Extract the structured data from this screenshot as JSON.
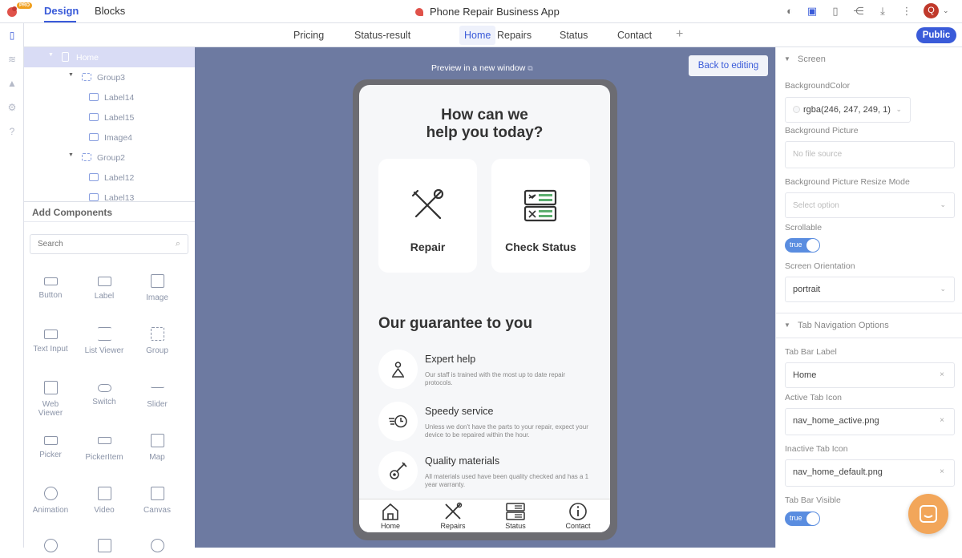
{
  "topbar": {
    "pro_badge": "PRO",
    "tabs": [
      {
        "label": "Design"
      },
      {
        "label": "Blocks"
      }
    ],
    "app_title": "Phone Repair Business App",
    "avatar_letter": "Q",
    "icons": [
      "contrast-icon",
      "tablet-frame-icon",
      "phone-icon",
      "share-icon",
      "download-icon",
      "more-vertical-icon"
    ]
  },
  "screen_tabs": {
    "items": [
      {
        "label": "Pricing"
      },
      {
        "label": "Status-result"
      },
      {
        "label": "Home"
      },
      {
        "label": "Repairs"
      },
      {
        "label": "Status"
      },
      {
        "label": "Contact"
      }
    ],
    "add_label": "+",
    "public_label": "Public",
    "active": "Home"
  },
  "tree": {
    "items": [
      {
        "label": "Home"
      },
      {
        "label": "Group3"
      },
      {
        "label": "Label14"
      },
      {
        "label": "Label15"
      },
      {
        "label": "Image4"
      },
      {
        "label": "Group2"
      },
      {
        "label": "Label12"
      },
      {
        "label": "Label13"
      }
    ]
  },
  "components": {
    "header": "Add Components",
    "search_placeholder": "Search",
    "items": [
      {
        "label": "Button"
      },
      {
        "label": "Label"
      },
      {
        "label": "Image"
      },
      {
        "label": "Text Input"
      },
      {
        "label": "List Viewer"
      },
      {
        "label": "Group"
      },
      {
        "label": "Web Viewer"
      },
      {
        "label": "Switch"
      },
      {
        "label": "Slider"
      },
      {
        "label": "Picker"
      },
      {
        "label": "PickerItem"
      },
      {
        "label": "Map"
      },
      {
        "label": "Animation"
      },
      {
        "label": "Video"
      },
      {
        "label": "Canvas"
      }
    ]
  },
  "canvas": {
    "preview_link": "Preview in a new window",
    "back_button": "Back to editing",
    "background": "#6d7aa1"
  },
  "phone": {
    "title_line1": "How can we",
    "title_line2": "help you today?",
    "cards": [
      {
        "label": "Repair"
      },
      {
        "label": "Check Status"
      }
    ],
    "guarantee_title": "Our guarantee to you",
    "features": [
      {
        "title": "Expert help",
        "desc": "Our staff is trained with the most up to date repair protocols."
      },
      {
        "title": "Speedy service",
        "desc": "Unless we don't have the parts to your repair, expect your device to be repaired within the hour."
      },
      {
        "title": "Quality materials",
        "desc": "All materials used have been quality checked and has a 1 year warranty."
      }
    ],
    "tabbar": [
      {
        "label": "Home"
      },
      {
        "label": "Repairs"
      },
      {
        "label": "Status"
      },
      {
        "label": "Contact"
      }
    ]
  },
  "properties": {
    "screen_section": "Screen",
    "background_color_label": "BackgroundColor",
    "background_color_value": "rgba(246, 247, 249, 1)",
    "background_picture_label": "Background Picture",
    "background_picture_placeholder": "No file source",
    "resize_mode_label": "Background Picture Resize Mode",
    "resize_mode_placeholder": "Select option",
    "scrollable_label": "Scrollable",
    "scrollable_value": "true",
    "orientation_label": "Screen Orientation",
    "orientation_value": "portrait",
    "tab_section": "Tab Navigation Options",
    "tab_bar_label_label": "Tab Bar Label",
    "tab_bar_label_value": "Home",
    "active_icon_label": "Active Tab Icon",
    "active_icon_value": "nav_home_active.png",
    "inactive_icon_label": "Inactive Tab Icon",
    "inactive_icon_value": "nav_home_default.png",
    "tab_visible_label": "Tab Bar Visible",
    "tab_visible_value": "true"
  },
  "colors": {
    "accent": "#3a5bd9",
    "canvas": "#6d7aa1",
    "chat": "#f2a65a"
  }
}
